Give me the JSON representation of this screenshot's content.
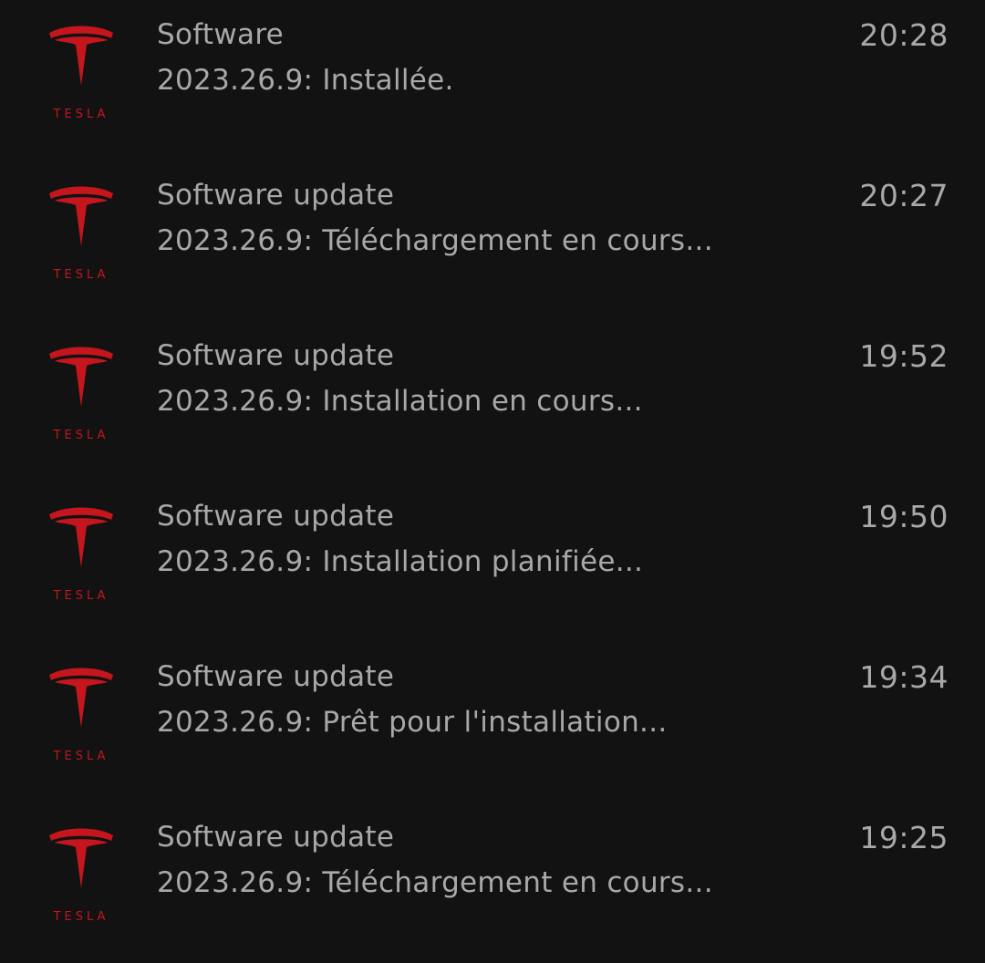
{
  "notifications": [
    {
      "app_logo": "tesla-logo",
      "logo_text": "TESLA",
      "title": "Software",
      "message": "2023.26.9: Installée.",
      "time": "20:28"
    },
    {
      "app_logo": "tesla-logo",
      "logo_text": "TESLA",
      "title": "Software update",
      "message": "2023.26.9: Téléchargement en cours...",
      "time": "20:27"
    },
    {
      "app_logo": "tesla-logo",
      "logo_text": "TESLA",
      "title": "Software update",
      "message": "2023.26.9: Installation en cours...",
      "time": "19:52"
    },
    {
      "app_logo": "tesla-logo",
      "logo_text": "TESLA",
      "title": "Software update",
      "message": "2023.26.9: Installation planifiée...",
      "time": "19:50"
    },
    {
      "app_logo": "tesla-logo",
      "logo_text": "TESLA",
      "title": "Software update",
      "message": "2023.26.9: Prêt pour l'installation...",
      "time": "19:34"
    },
    {
      "app_logo": "tesla-logo",
      "logo_text": "TESLA",
      "title": "Software update",
      "message": "2023.26.9: Téléchargement en cours...",
      "time": "19:25"
    }
  ],
  "colors": {
    "background": "#121212",
    "text": "#a8a8a8",
    "brand_red": "#c4161c"
  }
}
